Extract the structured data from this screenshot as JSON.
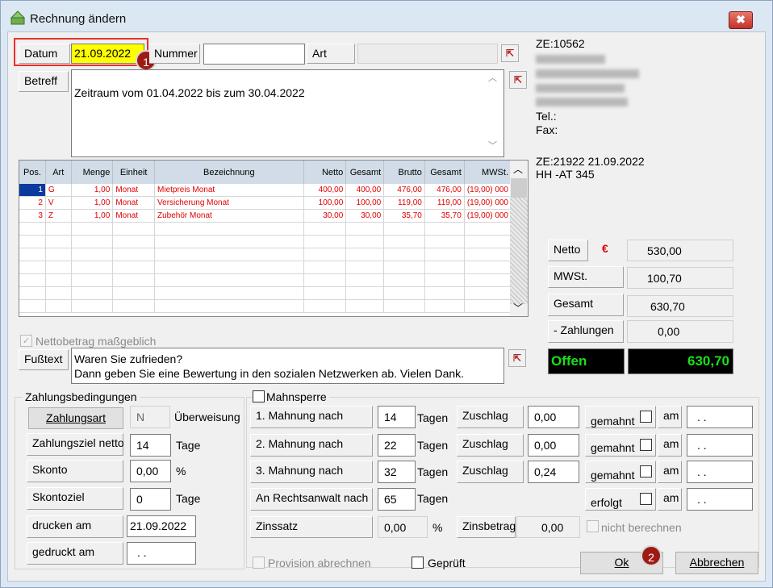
{
  "window": {
    "title": "Rechnung  ändern",
    "close_label": "✖"
  },
  "header": {
    "datum_label": "Datum",
    "datum_value": "21.09.2022",
    "nummer_label": "Nummer",
    "nummer_value": "",
    "art_label": "Art",
    "art_value": "",
    "betreff_label": "Betreff",
    "betreff_value": "Zeitraum vom 01.04.2022 bis zum 30.04.2022"
  },
  "contact": {
    "ze_line": "ZE:10562",
    "tel_label": "Tel.:",
    "fax_label": "Fax:",
    "ze2_line": "ZE:21922 21.09.2022",
    "kennzeichen": "HH -AT 345"
  },
  "table": {
    "columns": [
      "Pos.",
      "Art",
      "Menge",
      "Einheit",
      "Bezeichnung",
      "Netto",
      "Gesamt",
      "Brutto",
      "Gesamt",
      "MWSt."
    ],
    "rows": [
      [
        "1",
        "G",
        "1,00",
        "Monat",
        "Mietpreis Monat",
        "400,00",
        "400,00",
        "476,00",
        "476,00",
        "000 (19,00)"
      ],
      [
        "2",
        "V",
        "1,00",
        "Monat",
        "Versicherung Monat",
        "100,00",
        "100,00",
        "119,00",
        "119,00",
        "000 (19,00)"
      ],
      [
        "3",
        "Z",
        "1,00",
        "Monat",
        "Zubehör Monat",
        "30,00",
        "30,00",
        "35,70",
        "35,70",
        "000 (19,00)"
      ]
    ]
  },
  "totals": {
    "netto_label": "Netto",
    "currency": "€",
    "netto_value": "530,00",
    "mwst_label": "MWSt.",
    "mwst_value": "100,70",
    "gesamt_label": "Gesamt",
    "gesamt_value": "630,70",
    "zahlungen_label": "- Zahlungen",
    "zahlungen_value": "0,00",
    "offen_label": "Offen",
    "offen_value": "630,70"
  },
  "netto_checkbox_label": "Nettobetrag maßgeblich",
  "fusstext": {
    "label": "Fußtext",
    "line1": "Waren Sie zufrieden?",
    "line2": "Dann geben Sie eine Bewertung in den sozialen Netzwerken ab. Vielen Dank."
  },
  "payment": {
    "group_title": "Zahlungsbedingungen",
    "zahlungsart_button": "Zahlungsart",
    "zahlungsart_code": "N",
    "zahlungsart_text": "Überweisung",
    "ziel_label": "Zahlungsziel netto",
    "ziel_value": "14",
    "ziel_unit": "Tage",
    "skonto_label": "Skonto",
    "skonto_value": "0,00",
    "skonto_unit": "%",
    "skontoziel_label": "Skontoziel",
    "skontoziel_value": "0",
    "skontoziel_unit": "Tage",
    "drucken_label": "drucken am",
    "drucken_value": "21.09.2022",
    "gedruckt_label": "gedruckt am",
    "gedruckt_value": ". ."
  },
  "dunning": {
    "mahnsperre_label": "Mahnsperre",
    "rows": [
      {
        "label": "1. Mahnung nach",
        "days": "14",
        "unit": "Tagen",
        "zuschlag_label": "Zuschlag",
        "zuschlag": "0,00",
        "status": "gemahnt",
        "am_label": "am",
        "am_value": ". ."
      },
      {
        "label": "2. Mahnung nach",
        "days": "22",
        "unit": "Tagen",
        "zuschlag_label": "Zuschlag",
        "zuschlag": "0,00",
        "status": "gemahnt",
        "am_label": "am",
        "am_value": ". ."
      },
      {
        "label": "3. Mahnung nach",
        "days": "32",
        "unit": "Tagen",
        "zuschlag_label": "Zuschlag",
        "zuschlag": "0,24",
        "status": "gemahnt",
        "am_label": "am",
        "am_value": ". ."
      },
      {
        "label": "An Rechtsanwalt nach",
        "days": "65",
        "unit": "Tagen",
        "status": "erfolgt",
        "am_label": "am",
        "am_value": ". ."
      }
    ],
    "zinssatz_label": "Zinssatz",
    "zinssatz_value": "0,00",
    "zinssatz_unit": "%",
    "zinsbetrag_label": "Zinsbetrag",
    "zinsbetrag_value": "0,00",
    "nicht_berechnen_label": "nicht berechnen"
  },
  "footer": {
    "provision_label": "Provision abrechnen",
    "geprueft_label": "Geprüft",
    "ok_label": "Ok",
    "abbrechen_label": "Abbrechen"
  },
  "badges": {
    "b1": "1",
    "b2": "2"
  },
  "colors": {
    "highlight_field": "#ffff00",
    "red_outline": "#e8312a",
    "badge": "#9e1b14",
    "offen_green": "#19e019",
    "table_text": "#e00000"
  }
}
